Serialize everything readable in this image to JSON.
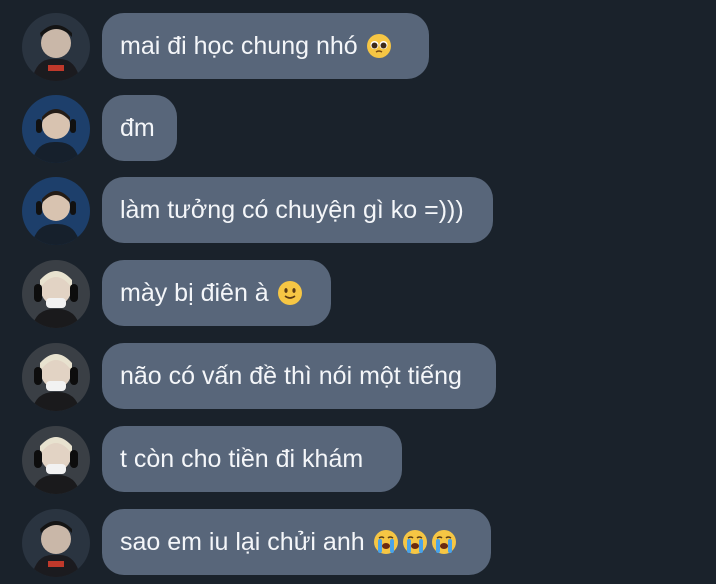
{
  "colors": {
    "background": "#1a222b",
    "bubble": "#58667a",
    "text": "#f4f6f9"
  },
  "messages": [
    {
      "text": "mai đi học chung nhó",
      "emoji": "pleading-face-icon",
      "avatar": "avatar-dark-portrait"
    },
    {
      "text": "đm",
      "emoji": "",
      "avatar": "avatar-headset-blue"
    },
    {
      "text": "làm tưởng có chuyện gì ko =)))",
      "emoji": "",
      "avatar": "avatar-headset-blue"
    },
    {
      "text": "mày bị điên à",
      "emoji": "slightly-smiling-face-icon",
      "avatar": "avatar-blond-headphones"
    },
    {
      "text": "não có vấn đề thì nói một tiếng",
      "emoji": "",
      "avatar": "avatar-blond-headphones"
    },
    {
      "text": "t còn cho tiền đi khám",
      "emoji": "",
      "avatar": "avatar-blond-headphones"
    },
    {
      "text": "sao em iu lại chửi anh",
      "emoji": "loudly-crying-face-icon x3",
      "avatar": "avatar-dark-portrait"
    }
  ]
}
